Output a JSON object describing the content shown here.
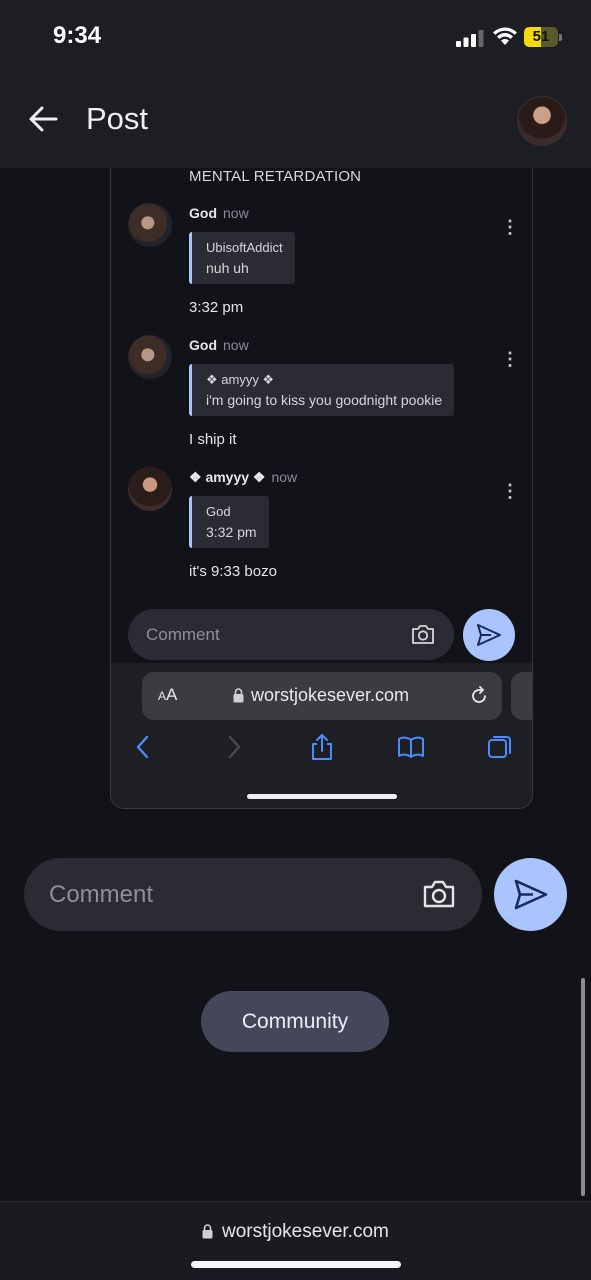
{
  "status_bar": {
    "time": "9:34",
    "battery": "51",
    "battery_level": 0.51
  },
  "header": {
    "title": "Post"
  },
  "embedded": {
    "heading": "MENTAL RETARDATION",
    "comments": [
      {
        "author": "God",
        "ago": "now",
        "quote_author": "UbisoftAddict",
        "quote_text": "nuh uh",
        "text": "3:32 pm"
      },
      {
        "author": "God",
        "ago": "now",
        "quote_author": "❖ amyyy ❖",
        "quote_text": "i'm going to kiss you goodnight pookie",
        "text": "I ship it"
      },
      {
        "author": "❖ amyyy ❖",
        "ago": "now",
        "quote_author": "God",
        "quote_text": "3:32 pm",
        "text": "it's 9:33 bozo"
      }
    ],
    "comment_placeholder": "Comment",
    "safari": {
      "aa_big": "A",
      "aa_small": "A",
      "url": "worstjokesever.com"
    }
  },
  "comment_box": {
    "placeholder": "Comment"
  },
  "community_button": "Community",
  "bottom_bar": {
    "url": "worstjokesever.com"
  },
  "colors": {
    "accent": "#a9c4ff",
    "background": "#121319",
    "battery": "#f5d90a",
    "safari_blue": "#4a8cff"
  }
}
